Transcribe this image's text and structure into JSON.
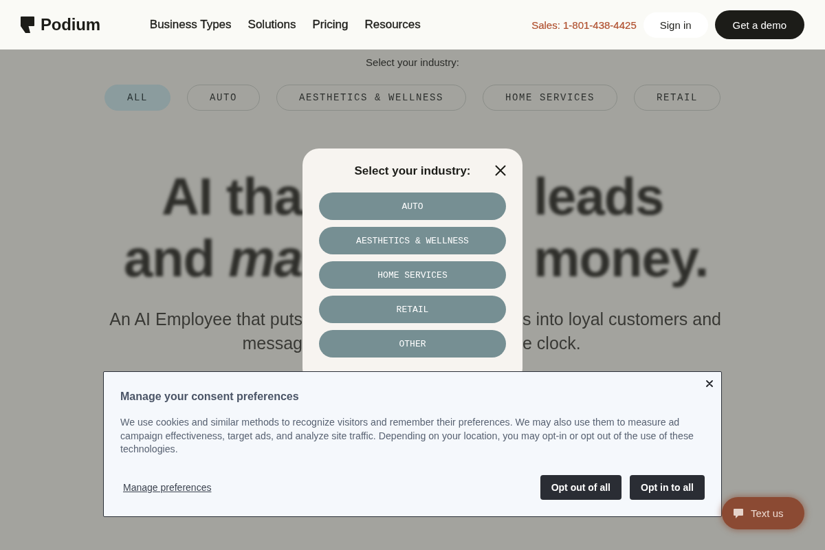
{
  "header": {
    "logo": "Podium",
    "nav": [
      "Business Types",
      "Solutions",
      "Pricing",
      "Resources"
    ],
    "sales_phone": "Sales: 1-801-438-4425",
    "sign_in": "Sign in",
    "demo_button": "Get a demo"
  },
  "page": {
    "filter_label": "Select your industry:",
    "filters": [
      {
        "label": "ALL",
        "selected": true
      },
      {
        "label": "AUTO",
        "selected": false
      },
      {
        "label": "AESTHETICS & WELLNESS",
        "selected": false
      },
      {
        "label": "HOME SERVICES",
        "selected": false
      },
      {
        "label": "RETAIL",
        "selected": false
      }
    ],
    "headline": [
      {
        "left": "AI tha",
        "right": "leads"
      },
      {
        "left": "and *ma*",
        "right": "money."
      }
    ],
    "subheadline": [
      {
        "left": "An AI Employee that puts",
        "right": "s into loyal customers and"
      },
      {
        "left": "messag",
        "right": "e clock."
      }
    ]
  },
  "industry_modal": {
    "title": "Select your industry:",
    "options": [
      "AUTO",
      "AESTHETICS & WELLNESS",
      "HOME SERVICES",
      "RETAIL",
      "OTHER"
    ]
  },
  "consent_banner": {
    "title": "Manage your consent preferences",
    "body": "We use cookies and similar methods to recognize visitors and remember their preferences. We may also use them to measure ad campaign effectiveness, target ads, and analyze site traffic. Depending on your location, you may opt-in or opt out of the use of these technologies.",
    "manage_link": "Manage preferences",
    "buttons": [
      "Opt out of all",
      "Opt in to all"
    ]
  },
  "chat_button": {
    "label": "Text us"
  }
}
